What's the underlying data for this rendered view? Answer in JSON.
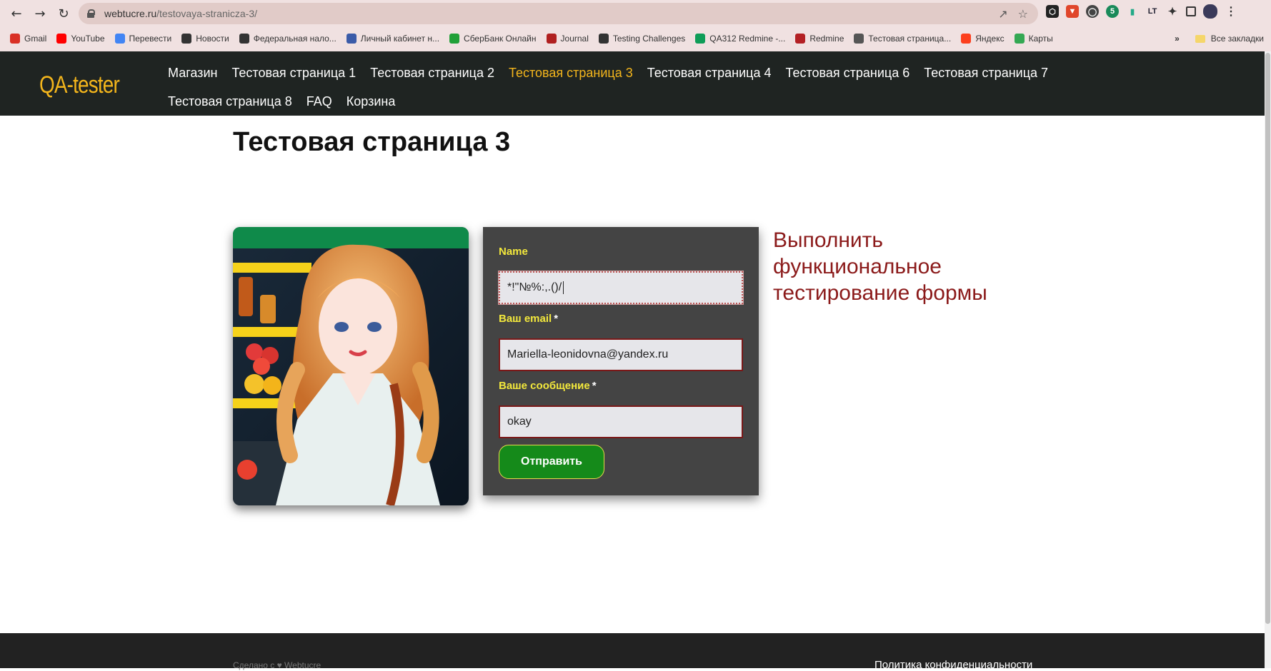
{
  "browser": {
    "url_host": "webtucre.ru",
    "url_path": "/testovaya-stranicza-3/",
    "bookmarks": [
      {
        "label": "Gmail",
        "icon": "gmail-icon",
        "color": "#d93025"
      },
      {
        "label": "YouTube",
        "icon": "youtube-icon",
        "color": "#ff0000"
      },
      {
        "label": "Перевести",
        "icon": "translate-icon",
        "color": "#4285f4"
      },
      {
        "label": "Новости",
        "icon": "news-icon",
        "color": "#333333"
      },
      {
        "label": "Федеральная нало...",
        "icon": "globe-icon",
        "color": "#333333"
      },
      {
        "label": "Личный кабинет н...",
        "icon": "emblem-icon",
        "color": "#3a5ba8"
      },
      {
        "label": "СберБанк Онлайн",
        "icon": "sber-icon",
        "color": "#21a038"
      },
      {
        "label": "Journal",
        "icon": "journal-icon",
        "color": "#b02020"
      },
      {
        "label": "Testing Challenges",
        "icon": "globe-icon",
        "color": "#333333"
      },
      {
        "label": "QA312 Redmine -...",
        "icon": "sheets-icon",
        "color": "#0f9d58"
      },
      {
        "label": "Redmine",
        "icon": "redmine-icon",
        "color": "#b32024"
      },
      {
        "label": "Тестовая страница...",
        "icon": "page-icon",
        "color": "#555555"
      },
      {
        "label": "Яндекс",
        "icon": "yandex-icon",
        "color": "#fc3f1d"
      },
      {
        "label": "Карты",
        "icon": "maps-icon",
        "color": "#34a853"
      }
    ],
    "all_bookmarks": "Все закладки",
    "more": "»"
  },
  "site": {
    "logo": "QA-tester",
    "nav_row1": [
      "Магазин",
      "Тестовая страница 1",
      "Тестовая страница 2",
      "Тестовая страница 3",
      "Тестовая страница 4",
      "Тестовая страница 6",
      "Тестовая страница 7"
    ],
    "nav_row2": [
      "Тестовая страница 8",
      "FAQ",
      "Корзина"
    ],
    "active_nav": "Тестовая страница 3",
    "accent": "#f3b51c"
  },
  "page": {
    "title": "Тестовая страница 3",
    "task_text": "Выполнить функциональное тестирование формы"
  },
  "form": {
    "name_label": "Name",
    "name_value": "*!\"№%:,.()/",
    "email_label": "Ваш email",
    "email_value": "Mariella-leonidovna@yandex.ru",
    "message_label": "Ваше сообщение",
    "message_value": "okay",
    "required_mark": "*",
    "submit_label": "Отправить"
  },
  "footer": {
    "made_with": "Сделано с ♥ Webtucre",
    "policy": "Политика конфиденциальности"
  }
}
